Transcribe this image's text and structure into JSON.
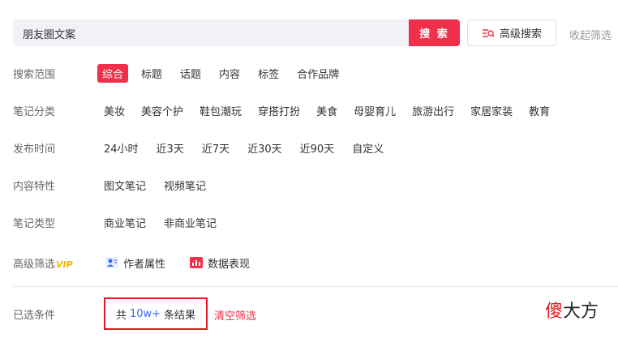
{
  "search": {
    "query": "朋友圈文案",
    "search_label": "搜 索",
    "advanced_label": "高级搜索",
    "collapse_label": "收起筛选"
  },
  "filters": {
    "scope": {
      "label": "搜索范围",
      "options": [
        "综合",
        "标题",
        "话题",
        "内容",
        "标签",
        "合作品牌"
      ]
    },
    "category": {
      "label": "笔记分类",
      "options": [
        "美妆",
        "美容个护",
        "鞋包潮玩",
        "穿搭打扮",
        "美食",
        "母婴育儿",
        "旅游出行",
        "家居家装",
        "教育"
      ]
    },
    "time": {
      "label": "发布时间",
      "options": [
        "24小时",
        "近3天",
        "近7天",
        "近30天",
        "近90天",
        "自定义"
      ]
    },
    "content": {
      "label": "内容特性",
      "options": [
        "图文笔记",
        "视频笔记"
      ]
    },
    "type": {
      "label": "笔记类型",
      "options": [
        "商业笔记",
        "非商业笔记"
      ]
    },
    "advanced": {
      "label": "高级筛选",
      "vip": "VIP",
      "options": [
        "作者属性",
        "数据表现"
      ]
    }
  },
  "selected": {
    "label": "已选条件",
    "prefix": "共",
    "count": "10w+",
    "suffix": "条结果",
    "clear_label": "清空筛选"
  },
  "watermark": {
    "part1": "傻",
    "part2": "大方"
  },
  "colors": {
    "accent": "#f0304a",
    "highlight_box": "#e0191f",
    "count_blue": "#3a66ff",
    "vip_gold": "#f5b400"
  }
}
